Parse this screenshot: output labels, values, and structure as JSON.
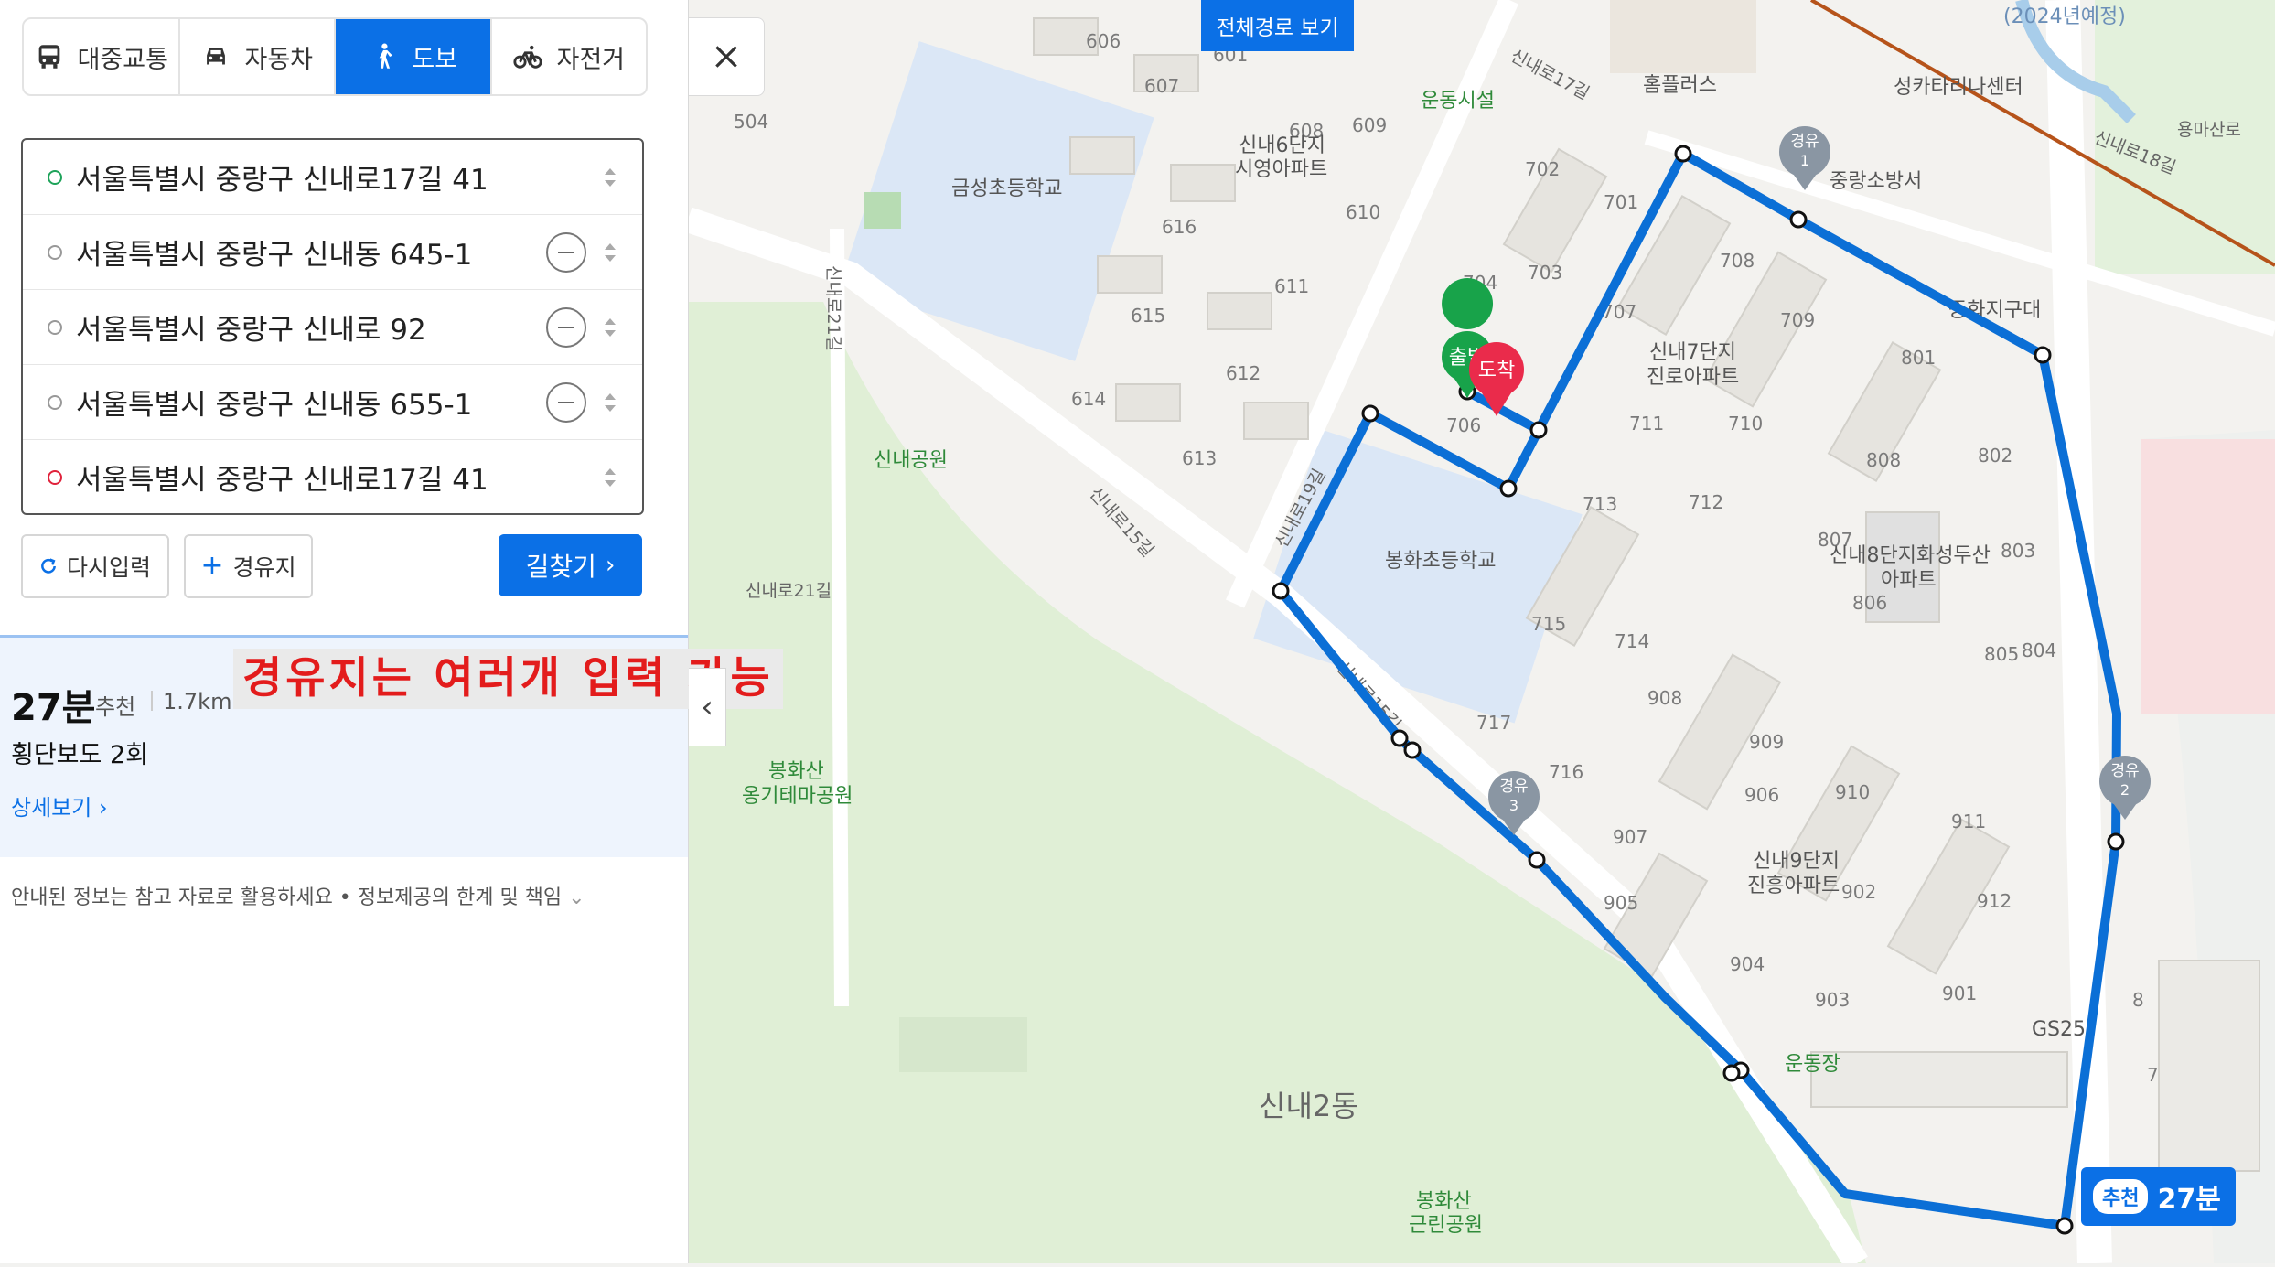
{
  "modes": [
    {
      "label": "대중교통",
      "icon": "bus-icon",
      "active": false
    },
    {
      "label": "자동차",
      "icon": "car-icon",
      "active": false
    },
    {
      "label": "도보",
      "icon": "walk-icon",
      "active": true
    },
    {
      "label": "자전거",
      "icon": "bicycle-icon",
      "active": false
    }
  ],
  "stops": [
    {
      "text": "서울특별시 중랑구 신내로17길 41",
      "type": "start",
      "dot_color": "#1ea35a"
    },
    {
      "text": "서울특별시 중랑구 신내동 645-1",
      "type": "waypoint",
      "dot_color": "#999999"
    },
    {
      "text": "서울특별시 중랑구 신내로 92",
      "type": "waypoint",
      "dot_color": "#999999"
    },
    {
      "text": "서울특별시 중랑구 신내동 655-1",
      "type": "waypoint",
      "dot_color": "#999999"
    },
    {
      "text": "서울특별시 중랑구 신내로17길 41",
      "type": "end",
      "dot_color": "#e0223b"
    }
  ],
  "buttons": {
    "reset": "다시입력",
    "add_waypoint": "경유지",
    "find": "길찾기"
  },
  "result": {
    "time": "27분",
    "recommend": "추천",
    "distance": "1.7km",
    "crossings": "횡단보도 2회",
    "detail": "상세보기"
  },
  "annotation": "경유지는 여러개 입력 가능",
  "disclaimer": "안내된 정보는 참고 자료로 활용하세요 • 정보제공의 한계 및 책임",
  "map": {
    "full_route_button": "전체경로 보기",
    "summary_badge": {
      "label": "추천",
      "time": "27분"
    },
    "start_marker": "출발",
    "end_marker": "도착",
    "waypoint_markers": [
      {
        "title": "경유",
        "num": "1"
      },
      {
        "title": "경유",
        "num": "2"
      },
      {
        "title": "경유",
        "num": "3"
      }
    ],
    "route_color": "#0b6fd6",
    "labels": {
      "school1": "금성초등학교",
      "school2": "봉화초등학교",
      "sports": "운동시설",
      "homeplus": "홈플러스",
      "church": "성카타리나센터",
      "firestation": "중랑소방서",
      "police": "중화지구대",
      "park1": "신내공원",
      "park2a": "봉화산",
      "park2b": "옹기테마공원",
      "park3a": "봉화산",
      "park3b": "근린공원",
      "apt6a": "신내6단지",
      "apt6b": "시영아파트",
      "apt7a": "신내7단지",
      "apt7b": "진로아파트",
      "apt8a": "신내8단지화성두산",
      "apt8b": "아파트",
      "apt9a": "신내9단지",
      "apt9b": "진흥아파트",
      "gs25": "GS25",
      "field": "운동장",
      "district": "신내2동",
      "road1": "신내로17길",
      "road2": "신내로21길",
      "road3": "신내로21길",
      "road4": "신내로15길",
      "road5": "신내로19길",
      "road6": "신내로15길",
      "road7": "신내로18길",
      "road8": "용마산로",
      "planned": "(2024년예정)",
      "nums": [
        "606",
        "607",
        "601",
        "608",
        "609",
        "610",
        "616",
        "615",
        "614",
        "611",
        "612",
        "613",
        "504",
        "702",
        "701",
        "704",
        "703",
        "706",
        "707",
        "708",
        "709",
        "711",
        "710",
        "713",
        "712",
        "715",
        "714",
        "717",
        "716",
        "801",
        "802",
        "803",
        "804",
        "805",
        "806",
        "807",
        "808",
        "908",
        "909",
        "910",
        "911",
        "912",
        "907",
        "906",
        "905",
        "904",
        "903",
        "902",
        "901",
        "8",
        "7"
      ]
    }
  }
}
